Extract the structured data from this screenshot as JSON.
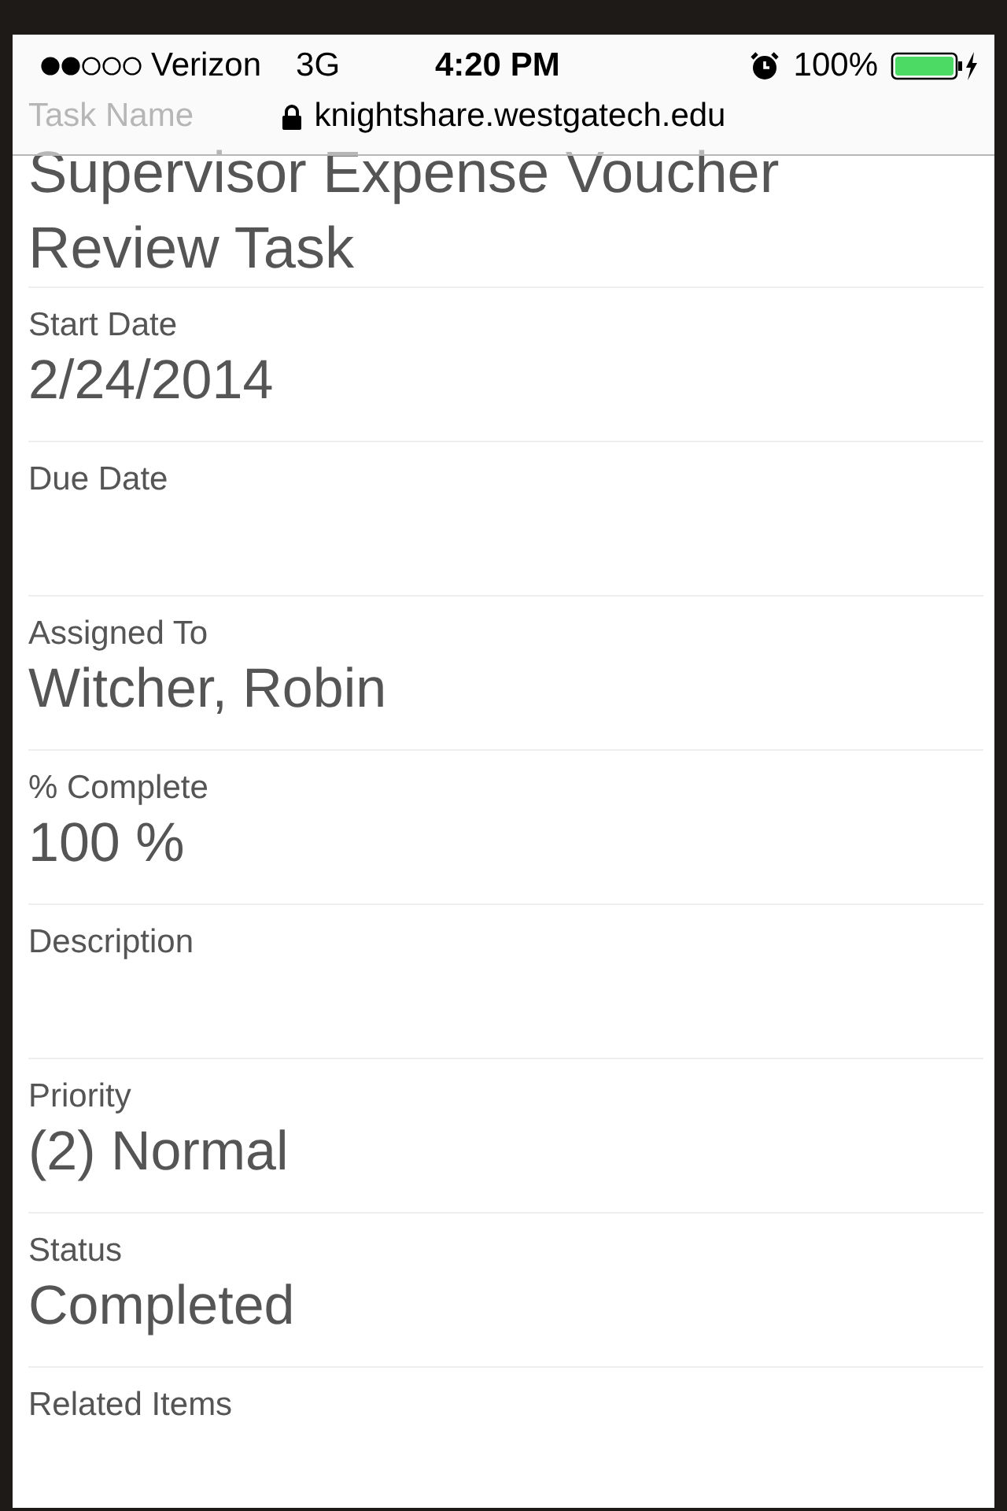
{
  "status_bar": {
    "carrier": "Verizon",
    "network": "3G",
    "time": "4:20 PM",
    "battery": "100%"
  },
  "address_bar": {
    "url": "knightshare.westgatech.edu"
  },
  "fields": [
    {
      "label": "Task Name",
      "value": "Supervisor Expense Voucher Review Task",
      "kind": "title"
    },
    {
      "label": "Start Date",
      "value": "2/24/2014",
      "kind": "text"
    },
    {
      "label": "Due Date",
      "kind": "text"
    },
    {
      "label": "Assigned To",
      "value": "Witcher, Robin",
      "kind": "text"
    },
    {
      "label": "% Complete",
      "value": "100 %",
      "kind": "text"
    },
    {
      "label": "Description",
      "kind": "text"
    },
    {
      "label": "Priority",
      "value": "(2) Normal",
      "kind": "text"
    },
    {
      "label": "Status",
      "value": "Completed",
      "kind": "text"
    },
    {
      "label": "Related Items",
      "kind": "text"
    }
  ]
}
